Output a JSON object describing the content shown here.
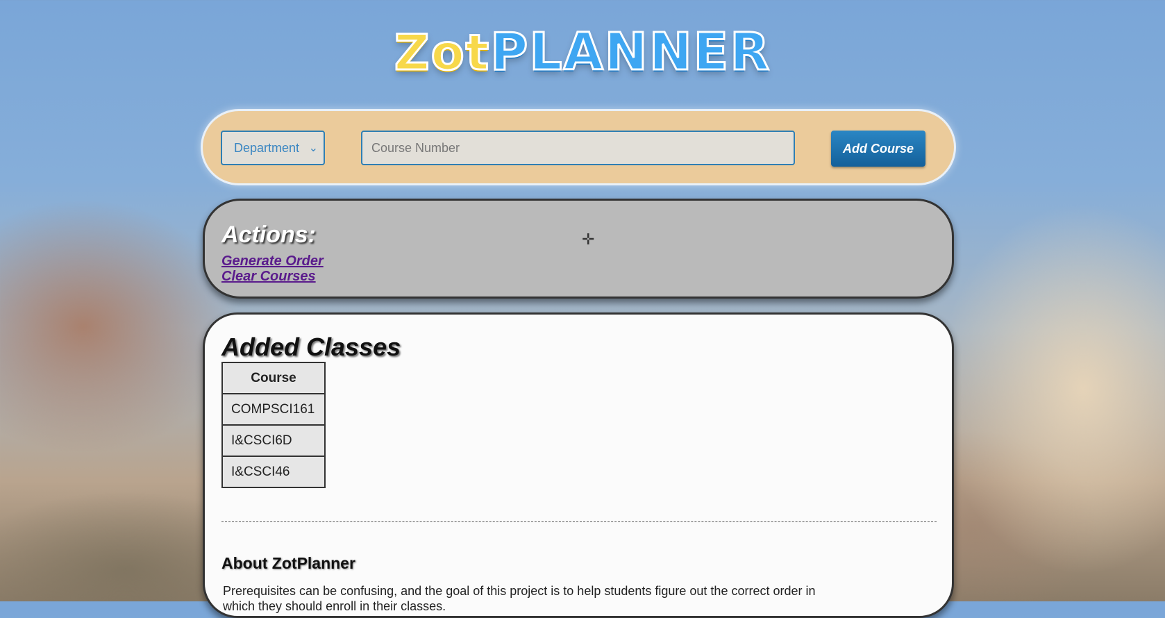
{
  "header": {
    "logo_part1": "Zot",
    "logo_part2": "PLANNER"
  },
  "search": {
    "department_label": "Department",
    "course_number_placeholder": "Course Number",
    "add_course_label": "Add Course"
  },
  "actions": {
    "title": "Actions:",
    "links": [
      "Generate Order",
      "Clear Courses"
    ]
  },
  "added_classes": {
    "title": "Added Classes",
    "column_header": "Course",
    "rows": [
      "COMPSCI161",
      "I&CSCI6D",
      "I&CSCI46"
    ]
  },
  "about": {
    "title": "About ZotPlanner",
    "text": "Prerequisites can be confusing, and the goal of this project is to help students figure out the correct order in which they should enroll in their classes."
  }
}
